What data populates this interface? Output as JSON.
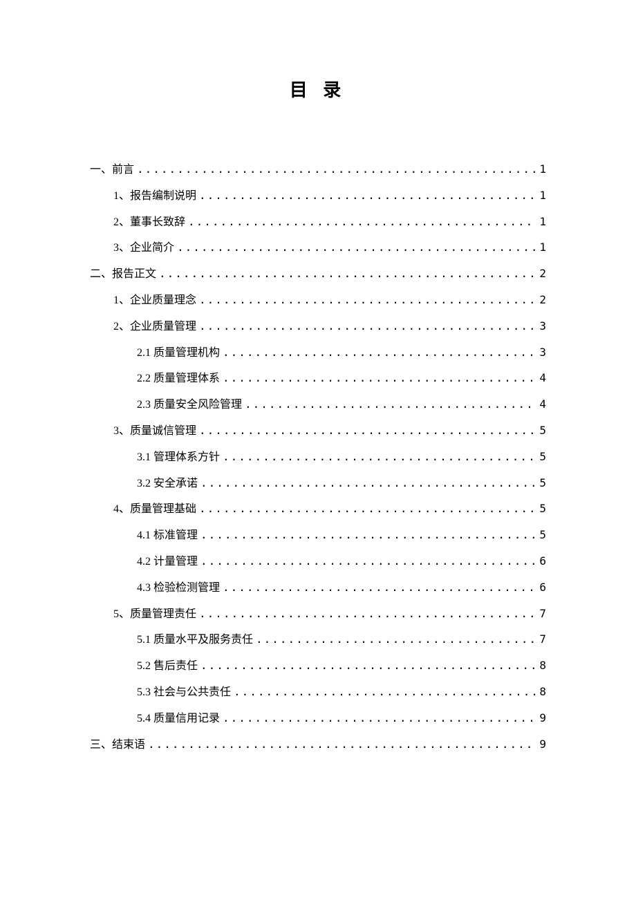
{
  "title": "目  录",
  "entries": [
    {
      "level": 0,
      "label": "一、前言",
      "page": "1"
    },
    {
      "level": 1,
      "label": "1、报告编制说明 ",
      "page": "1"
    },
    {
      "level": 1,
      "label": "2、董事长致辞 ",
      "page": "1"
    },
    {
      "level": 1,
      "label": "3、企业简介  ",
      "page": "1"
    },
    {
      "level": 0,
      "label": "二、报告正文",
      "page": "2"
    },
    {
      "level": 1,
      "label": "1、企业质量理念 ",
      "page": "2"
    },
    {
      "level": 1,
      "label": "2、企业质量管理 ",
      "page": "3"
    },
    {
      "level": 2,
      "label": "2.1 质量管理机构",
      "page": "3"
    },
    {
      "level": 2,
      "label": "2.2 质量管理体系",
      "page": "4"
    },
    {
      "level": 2,
      "label": "2.3 质量安全风险管理",
      "page": "4"
    },
    {
      "level": 1,
      "label": "3、质量诚信管理 ",
      "page": "5"
    },
    {
      "level": 2,
      "label": "3.1 管理体系方针  ",
      "page": "5"
    },
    {
      "level": 2,
      "label": "3.2 安全承诺  ",
      "page": "5"
    },
    {
      "level": 1,
      "label": "4、质量管理基础 ",
      "page": "5"
    },
    {
      "level": 2,
      "label": "4.1 标准管理",
      "page": "5"
    },
    {
      "level": 2,
      "label": "4.2 计量管理  ",
      "page": "6"
    },
    {
      "level": 2,
      "label": "4.3 检验检测管理",
      "page": "6"
    },
    {
      "level": 1,
      "label": "5、质量管理责任 ",
      "page": "7"
    },
    {
      "level": 2,
      "label": "5.1 质量水平及服务责任",
      "page": "7"
    },
    {
      "level": 2,
      "label": "5.2 售后责任",
      "page": "8"
    },
    {
      "level": 2,
      "label": "5.3 社会与公共责任",
      "page": "8"
    },
    {
      "level": 2,
      "label": "5.4 质量信用记录",
      "page": "9"
    },
    {
      "level": 0,
      "label": "三、结束语  ",
      "page": "9"
    }
  ]
}
